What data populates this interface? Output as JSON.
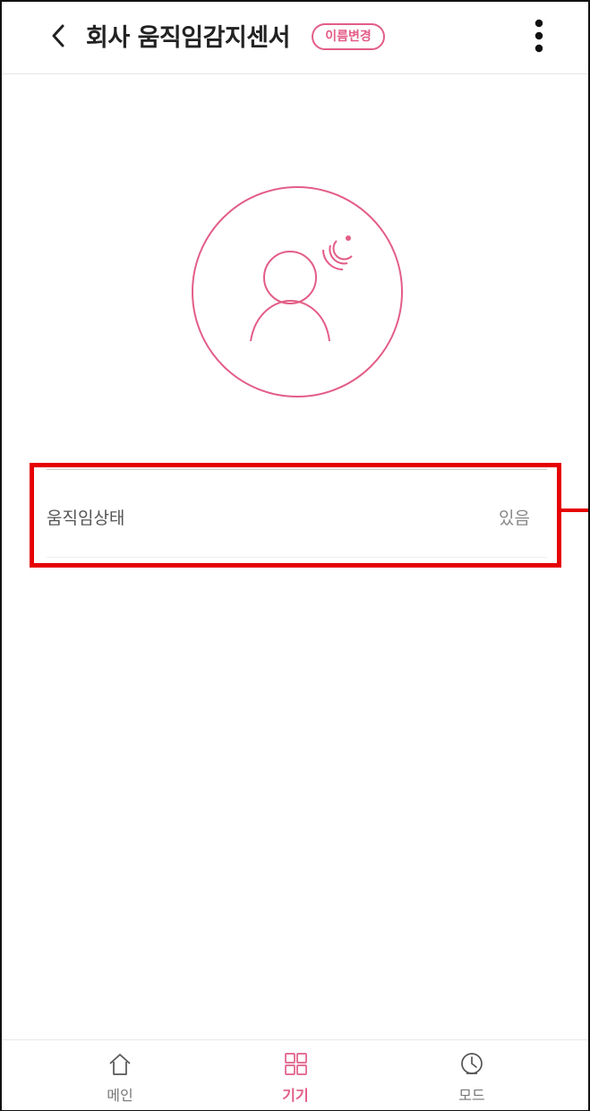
{
  "header": {
    "title": "회사 움직임감지센서",
    "rename_button": "이름변경",
    "back_icon": "chevron-left-icon",
    "more_icon": "more-vertical-icon"
  },
  "sensor": {
    "icon": "motion-sensor-person-icon"
  },
  "status": {
    "label": "움직임상태",
    "value": "있음"
  },
  "tabbar": {
    "items": [
      {
        "label": "메인",
        "icon": "home-icon",
        "active": false
      },
      {
        "label": "기기",
        "icon": "device-grid-icon",
        "active": true
      },
      {
        "label": "모드",
        "icon": "clock-icon",
        "active": false
      }
    ]
  },
  "colors": {
    "accent": "#e35d87",
    "highlight": "#e60000",
    "text": "#222222"
  }
}
